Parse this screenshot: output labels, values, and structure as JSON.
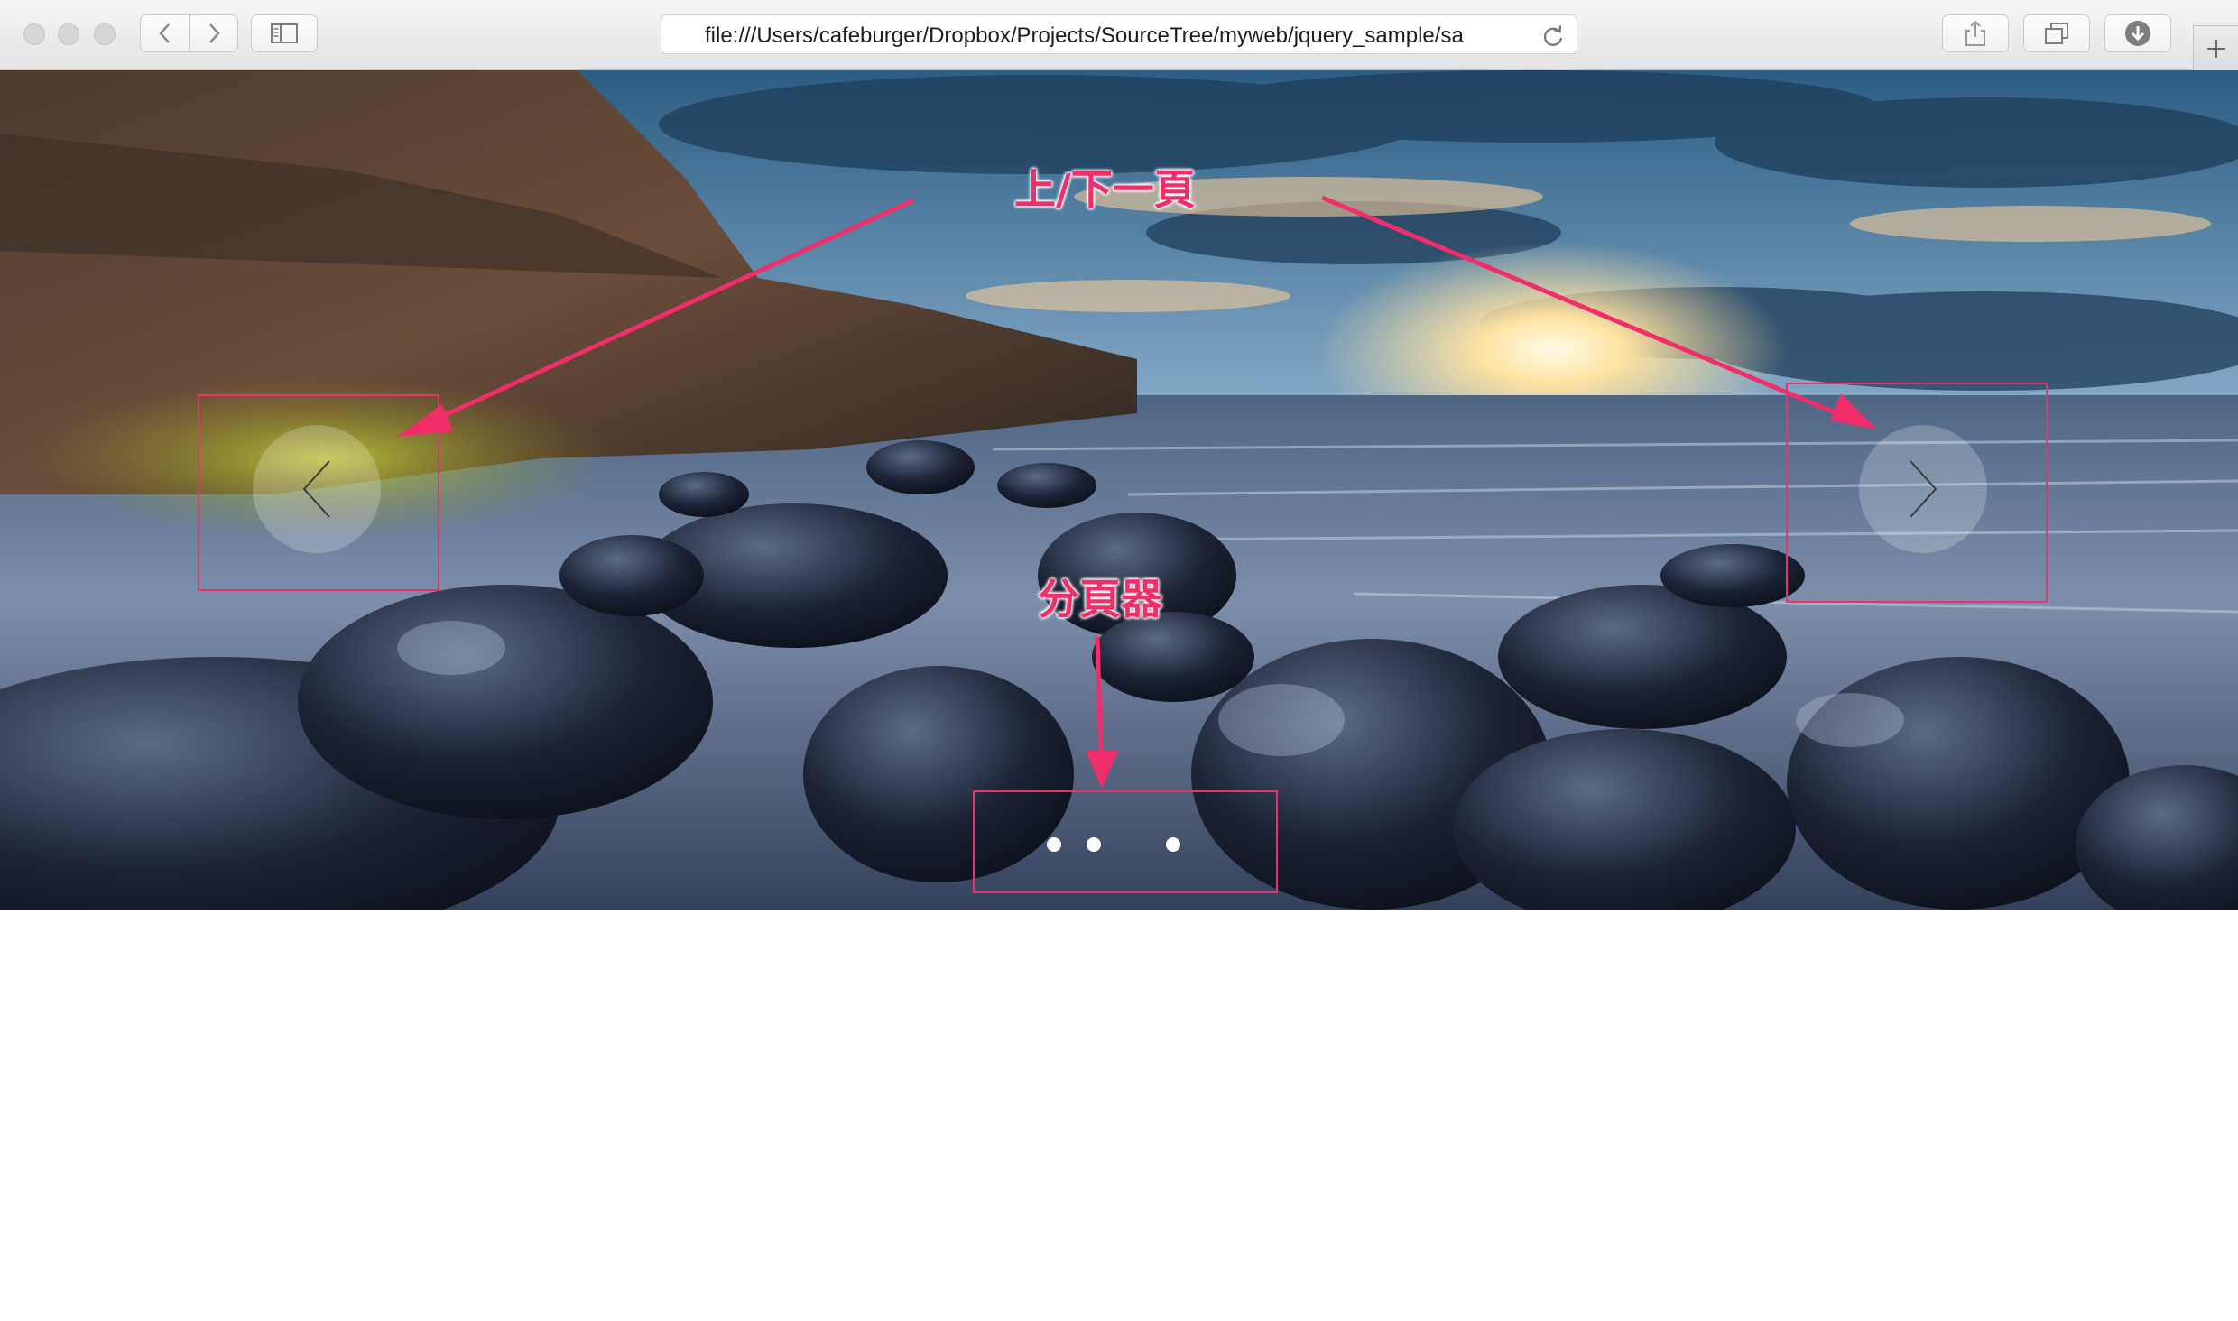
{
  "browser": {
    "url": "file:///Users/cafeburger/Dropbox/Projects/SourceTree/myweb/jquery_sample/sa",
    "icons": {
      "close": "window-close-icon",
      "minimize": "window-minimize-icon",
      "zoom": "window-zoom-icon",
      "back": "chevron-left-icon",
      "forward": "chevron-right-icon",
      "sidebar": "sidebar-icon",
      "reload": "reload-icon",
      "share": "share-icon",
      "tabs": "tabs-overview-icon",
      "downloads": "download-icon",
      "new_tab": "plus-icon"
    }
  },
  "carousel": {
    "prev_icon": "chevron-left-icon",
    "next_icon": "chevron-right-icon",
    "pager_dots": 4,
    "active_dot": 3
  },
  "annotations": {
    "nav_label": "上/下一頁",
    "pager_label": "分頁器",
    "color": "#e8336f"
  }
}
